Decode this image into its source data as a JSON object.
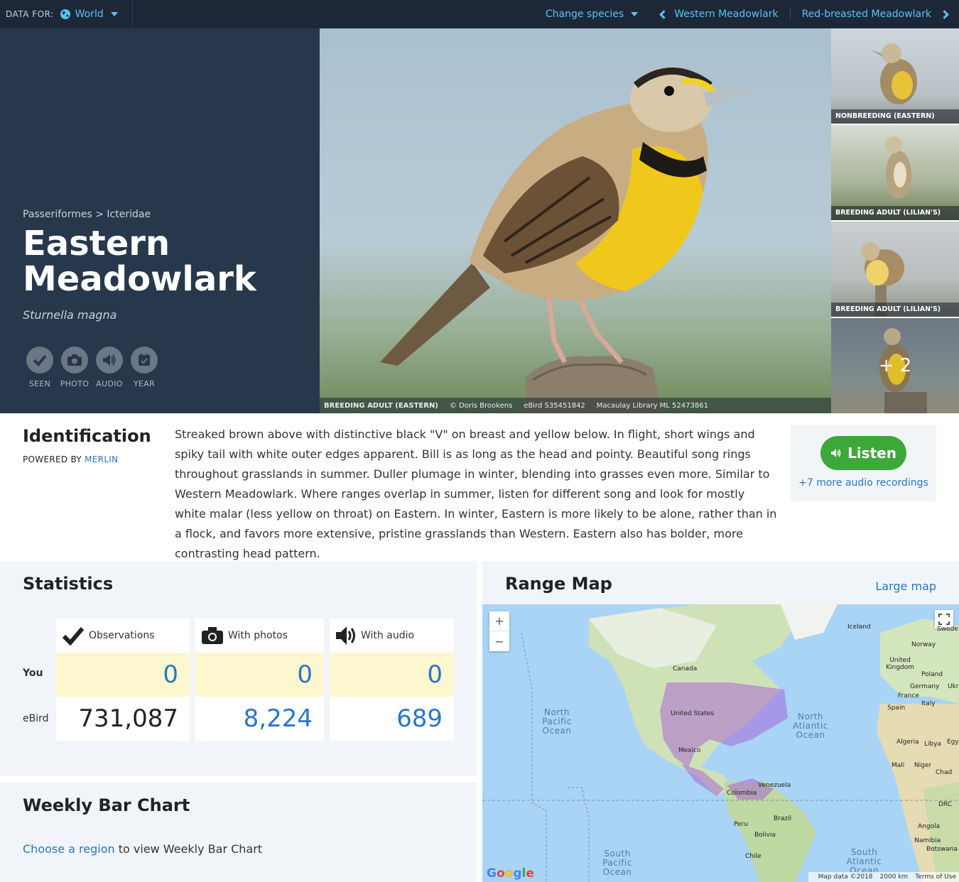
{
  "topbar": {
    "data_for_label": "DATA FOR:",
    "data_for_value": "World",
    "change_species": "Change species",
    "prev_species": "Western Meadowlark",
    "next_species": "Red-breasted Meadowlark"
  },
  "hero": {
    "breadcrumb": "Passeriformes > Icteridae",
    "common_name": "Eastern Meadowlark",
    "scientific_name": "Sturnella magna",
    "badges": [
      "SEEN",
      "PHOTO",
      "AUDIO",
      "YEAR"
    ],
    "caption": {
      "plumage": "BREEDING ADULT (EASTERN)",
      "credit": "© Doris Brookens",
      "ebird": "eBird S35451842",
      "macaulay": "Macaulay Library ML 52473861"
    },
    "thumbs": [
      "NONBREEDING (EASTERN)",
      "BREEDING ADULT (LILIAN'S)",
      "BREEDING ADULT (LILIAN'S)"
    ],
    "more_photos": "+ 2"
  },
  "identification": {
    "title": "Identification",
    "powered_by": "POWERED BY",
    "powered_link": "MERLIN",
    "text": "Streaked brown above with distinctive black \"V\" on breast and yellow below. In flight, short wings and spiky tail with white outer edges apparent. Bill is as long as the head and pointy. Beautiful song rings throughout grasslands in summer. Duller plumage in winter, blending into grasses even more. Similar to Western Meadowlark. Where ranges overlap in summer, listen for different song and look for mostly white malar (less yellow on throat) on Eastern. In winter, Eastern is more likely to be alone, rather than in a flock, and favors more extensive, pristine grasslands than Western. Eastern also has bolder, more contrasting head pattern.",
    "listen_label": "Listen",
    "more_audio": "+7 more audio recordings"
  },
  "statistics": {
    "title": "Statistics",
    "columns": [
      "Observations",
      "With photos",
      "With audio"
    ],
    "row_you": "You",
    "row_ebird": "eBird",
    "you": [
      "0",
      "0",
      "0"
    ],
    "ebird": [
      "731,087",
      "8,224",
      "689"
    ]
  },
  "weekly": {
    "title": "Weekly Bar Chart",
    "link": "Choose a region",
    "text": "to view Weekly Bar Chart"
  },
  "range_map": {
    "title": "Range Map",
    "large_map": "Large map",
    "labels": {
      "canada": "Canada",
      "united_states": "United States",
      "mexico": "Mexico",
      "colombia": "Colombia",
      "venezuela": "Venezuela",
      "peru": "Peru",
      "bolivia": "Bolivia",
      "brazil": "Brazil",
      "chile": "Chile",
      "iceland": "Iceland",
      "norway": "Norway",
      "sweden": "Swede",
      "uk": "United Kingdom",
      "poland": "Poland",
      "germany": "Germany",
      "ukr": "Ukr",
      "france": "France",
      "spain": "Spain",
      "italy": "Italy",
      "algeria": "Algeria",
      "libya": "Libya",
      "egypt": "Egyp",
      "mali": "Mali",
      "niger": "Niger",
      "chad": "Chad",
      "drc": "DRC",
      "angola": "Angola",
      "namibia": "Namibia",
      "botswana": "Botswana",
      "north_pacific": "North Pacific Ocean",
      "north_atlantic": "North Atlantic Ocean",
      "south_pacific": "South Pacific Ocean",
      "south_atlantic": "South Atlantic Ocean"
    },
    "google": "Google",
    "map_data": "Map data ©2018",
    "scale": "2000 km",
    "terms": "Terms of Use",
    "zoom_in": "+",
    "zoom_out": "−"
  },
  "colors": {
    "topbar": "#1c2838",
    "hero_left": "#27384c",
    "link": "#2a76c6",
    "listen": "#3da83a",
    "you_row": "#fcf7cf",
    "range": "#a24ed8"
  }
}
